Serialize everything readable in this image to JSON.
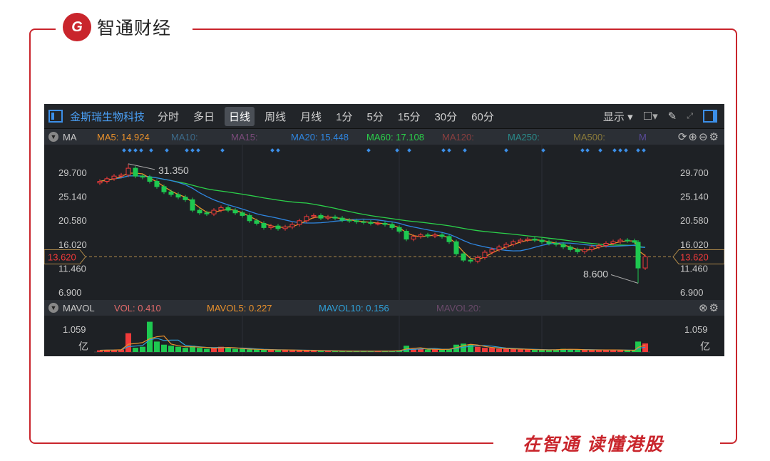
{
  "brand": {
    "logo_mark": "G",
    "name": "智通财经",
    "slogan": "在智通 读懂港股"
  },
  "toolbar": {
    "stock": "金斯瑞生物科技",
    "periods": [
      "分时",
      "多日",
      "日线",
      "周线",
      "月线",
      "1分",
      "5分",
      "15分",
      "30分",
      "60分"
    ],
    "active": "日线",
    "display": "显示"
  },
  "ma_row": {
    "label": "MA",
    "items": [
      {
        "t": "MA5: 14.924",
        "c": "#e8902c"
      },
      {
        "t": "MA10:",
        "c": "#3c6a8a"
      },
      {
        "t": "MA15:",
        "c": "#7a4a7a"
      },
      {
        "t": "MA20: 15.448",
        "c": "#2f86e0"
      },
      {
        "t": "MA60: 17.108",
        "c": "#2bd04a"
      },
      {
        "t": "MA120:",
        "c": "#8a3f3f"
      },
      {
        "t": "MA250:",
        "c": "#2a8a8a"
      },
      {
        "t": "MA500:",
        "c": "#8a7a3a"
      },
      {
        "t": "M",
        "c": "#5a4a9a"
      }
    ]
  },
  "vol_row": {
    "label": "MAVOL",
    "items": [
      {
        "t": "VOL: 0.410",
        "c": "#e06a6a"
      },
      {
        "t": "MAVOL5: 0.227",
        "c": "#e8902c"
      },
      {
        "t": "MAVOL10: 0.156",
        "c": "#2fa0d8"
      },
      {
        "t": "MAVOL20:",
        "c": "#6a4a6a"
      }
    ]
  },
  "colors": {
    "up": "#f03a3a",
    "down": "#1ec850",
    "ma5": "#e8902c",
    "ma20": "#2f86e0",
    "ma60": "#2bd04a"
  },
  "chart_data": {
    "type": "candlestick",
    "y_ticks": [
      "29.700",
      "25.140",
      "20.580",
      "16.020",
      "11.460",
      "6.900"
    ],
    "ylim": [
      6.9,
      29.7
    ],
    "current_price": "13.620",
    "high_label": "31.350",
    "low_label": "8.600",
    "high": 31.35,
    "low": 8.6,
    "closes": [
      28,
      28.5,
      29,
      29.2,
      30.5,
      29,
      28.8,
      28,
      27,
      26,
      25.5,
      25,
      24.5,
      22.5,
      22,
      21.8,
      22.5,
      23,
      22.5,
      22,
      21.5,
      20.5,
      20,
      19.2,
      19.5,
      19,
      19.3,
      19.8,
      20.5,
      21.3,
      21.5,
      21,
      21.2,
      21,
      20.6,
      20.5,
      20.3,
      20.2,
      20,
      20,
      19.8,
      19.2,
      18.5,
      17,
      17.5,
      17.8,
      17.6,
      17.8,
      17.5,
      16.5,
      14.2,
      13,
      12.8,
      13.5,
      14.5,
      15,
      15.5,
      16,
      16.5,
      16.8,
      17,
      16.8,
      16.5,
      16.2,
      16,
      15.5,
      15,
      14.6,
      15,
      15.5,
      15.8,
      16.2,
      16.5,
      16.8,
      16.7,
      16.4,
      11.5,
      13.62
    ],
    "volumes": [
      0.08,
      0.1,
      0.1,
      0.12,
      0.9,
      0.2,
      0.25,
      1.45,
      0.5,
      0.35,
      0.3,
      0.25,
      0.2,
      0.3,
      0.2,
      0.15,
      0.2,
      0.25,
      0.2,
      0.15,
      0.15,
      0.12,
      0.12,
      0.1,
      0.1,
      0.1,
      0.1,
      0.08,
      0.08,
      0.08,
      0.06,
      0.05,
      0.05,
      0.05,
      0.04,
      0.04,
      0.04,
      0.04,
      0.04,
      0.04,
      0.05,
      0.05,
      0.08,
      0.3,
      0.15,
      0.15,
      0.12,
      0.12,
      0.12,
      0.15,
      0.35,
      0.4,
      0.35,
      0.25,
      0.2,
      0.2,
      0.15,
      0.15,
      0.15,
      0.12,
      0.12,
      0.1,
      0.1,
      0.1,
      0.12,
      0.15,
      0.12,
      0.1,
      0.1,
      0.1,
      0.1,
      0.1,
      0.1,
      0.08,
      0.08,
      0.08,
      0.5,
      0.41
    ],
    "vol_tick": "1.059",
    "vol_unit": "亿",
    "vol_max_tick": 1.059
  }
}
